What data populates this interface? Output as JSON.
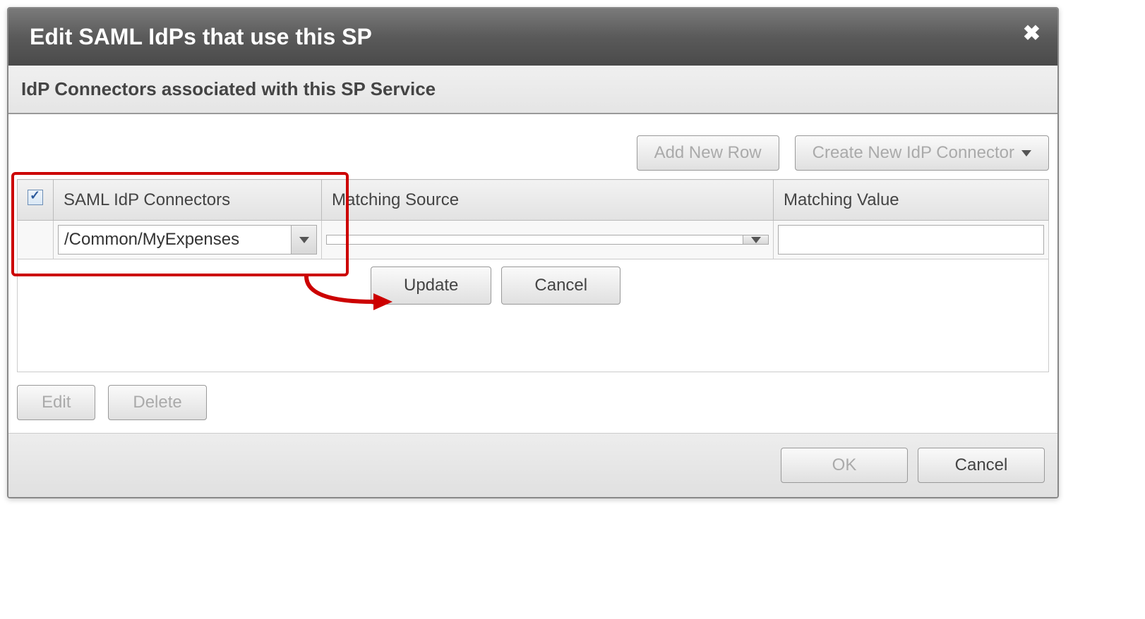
{
  "dialog": {
    "title": "Edit SAML IdPs that use this SP",
    "close_icon": "✖"
  },
  "section": {
    "title": "IdP Connectors associated with this SP Service"
  },
  "toolbar": {
    "add_row": "Add New Row",
    "create_connector": "Create New IdP Connector"
  },
  "table": {
    "headers": {
      "connectors": "SAML IdP Connectors",
      "matching_source": "Matching Source",
      "matching_value": "Matching Value"
    },
    "row": {
      "connector_value": "/Common/MyExpenses",
      "matching_source_value": "",
      "matching_value_input": ""
    }
  },
  "row_actions": {
    "update": "Update",
    "cancel": "Cancel"
  },
  "bottom_actions": {
    "edit": "Edit",
    "delete": "Delete"
  },
  "footer": {
    "ok": "OK",
    "cancel": "Cancel"
  }
}
